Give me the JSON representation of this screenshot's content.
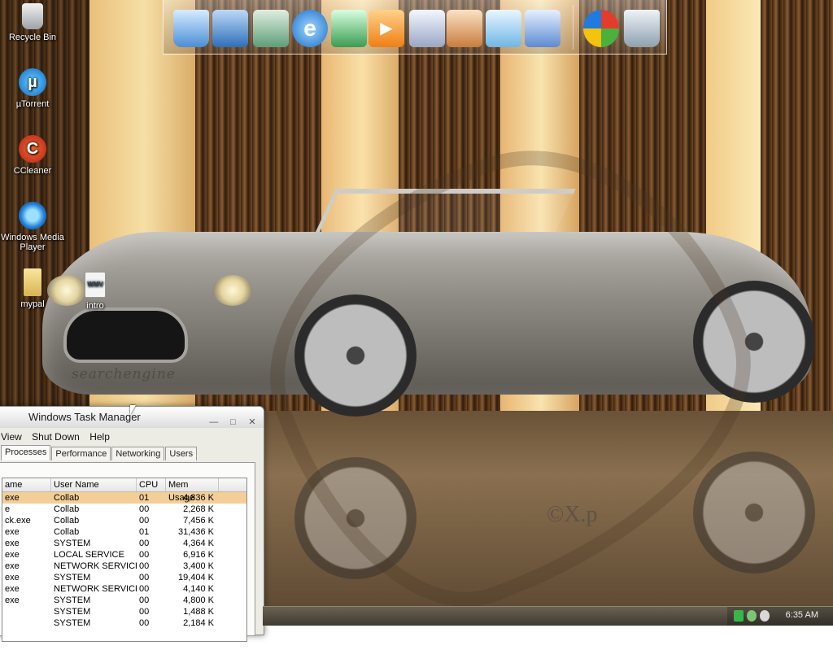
{
  "desktop": {
    "icons": [
      {
        "label": "Recycle Bin",
        "icon": "recycle-bin-icon"
      },
      {
        "label": "µTorrent",
        "icon": "utorrent-icon"
      },
      {
        "label": "CCleaner",
        "icon": "ccleaner-icon"
      },
      {
        "label": "Windows Media Player",
        "icon": "windows-media-player-icon"
      },
      {
        "label": "mypal",
        "icon": "folder-icon"
      },
      {
        "label": "intro",
        "icon": "wmv-file-icon",
        "badge": "WMV"
      }
    ],
    "wallpaper": {
      "watermark": "searchengine",
      "copyright": "©X.p"
    }
  },
  "dock": {
    "items": [
      {
        "name": "my-computer",
        "icon": "computer-icon"
      },
      {
        "name": "network",
        "icon": "network-icon"
      },
      {
        "name": "documents",
        "icon": "documents-icon"
      },
      {
        "name": "internet-explorer",
        "icon": "internet-explorer-icon",
        "glyph": "e"
      },
      {
        "name": "display",
        "icon": "monitor-icon"
      },
      {
        "name": "media-player",
        "icon": "media-player-icon",
        "glyph": "▶"
      },
      {
        "name": "calculator",
        "icon": "calculator-icon"
      },
      {
        "name": "paint",
        "icon": "paint-icon"
      },
      {
        "name": "notepad",
        "icon": "notepad-icon"
      },
      {
        "name": "disk",
        "icon": "disk-icon"
      },
      {
        "name": "start",
        "icon": "windows-start-icon"
      },
      {
        "name": "recycle-bin",
        "icon": "trash-icon"
      }
    ]
  },
  "taskmgr": {
    "title": "Windows Task Manager",
    "menu": [
      "View",
      "Shut Down",
      "Help"
    ],
    "tabs": [
      "Processes",
      "Performance",
      "Networking",
      "Users"
    ],
    "active_tab": "Processes",
    "columns": [
      "ame",
      "User Name",
      "CPU",
      "Mem Usage"
    ],
    "rows": [
      {
        "name": "exe",
        "user": "Collab",
        "cpu": "01",
        "mem": "4,836 K",
        "selected": true
      },
      {
        "name": "e",
        "user": "Collab",
        "cpu": "00",
        "mem": "2,268 K"
      },
      {
        "name": "ck.exe",
        "user": "Collab",
        "cpu": "00",
        "mem": "7,456 K"
      },
      {
        "name": "exe",
        "user": "Collab",
        "cpu": "01",
        "mem": "31,436 K"
      },
      {
        "name": "exe",
        "user": "SYSTEM",
        "cpu": "00",
        "mem": "4,364 K"
      },
      {
        "name": "exe",
        "user": "LOCAL SERVICE",
        "cpu": "00",
        "mem": "6,916 K"
      },
      {
        "name": "exe",
        "user": "NETWORK SERVICE",
        "cpu": "00",
        "mem": "3,400 K"
      },
      {
        "name": "exe",
        "user": "SYSTEM",
        "cpu": "00",
        "mem": "19,404 K"
      },
      {
        "name": "exe",
        "user": "NETWORK SERVICE",
        "cpu": "00",
        "mem": "4,140 K"
      },
      {
        "name": "exe",
        "user": "SYSTEM",
        "cpu": "00",
        "mem": "4,800 K"
      },
      {
        "name": "",
        "user": "SYSTEM",
        "cpu": "00",
        "mem": "1,488 K"
      },
      {
        "name": "",
        "user": "SYSTEM",
        "cpu": "00",
        "mem": "2,184 K"
      }
    ]
  },
  "taskbar": {
    "clock": "6:35 AM",
    "tray_icons": [
      "battery-icon",
      "utorrent-tray-icon",
      "network-tray-icon"
    ]
  },
  "colors": {
    "selected_row": "#f3cf97",
    "taskbar": "#4d473b"
  }
}
